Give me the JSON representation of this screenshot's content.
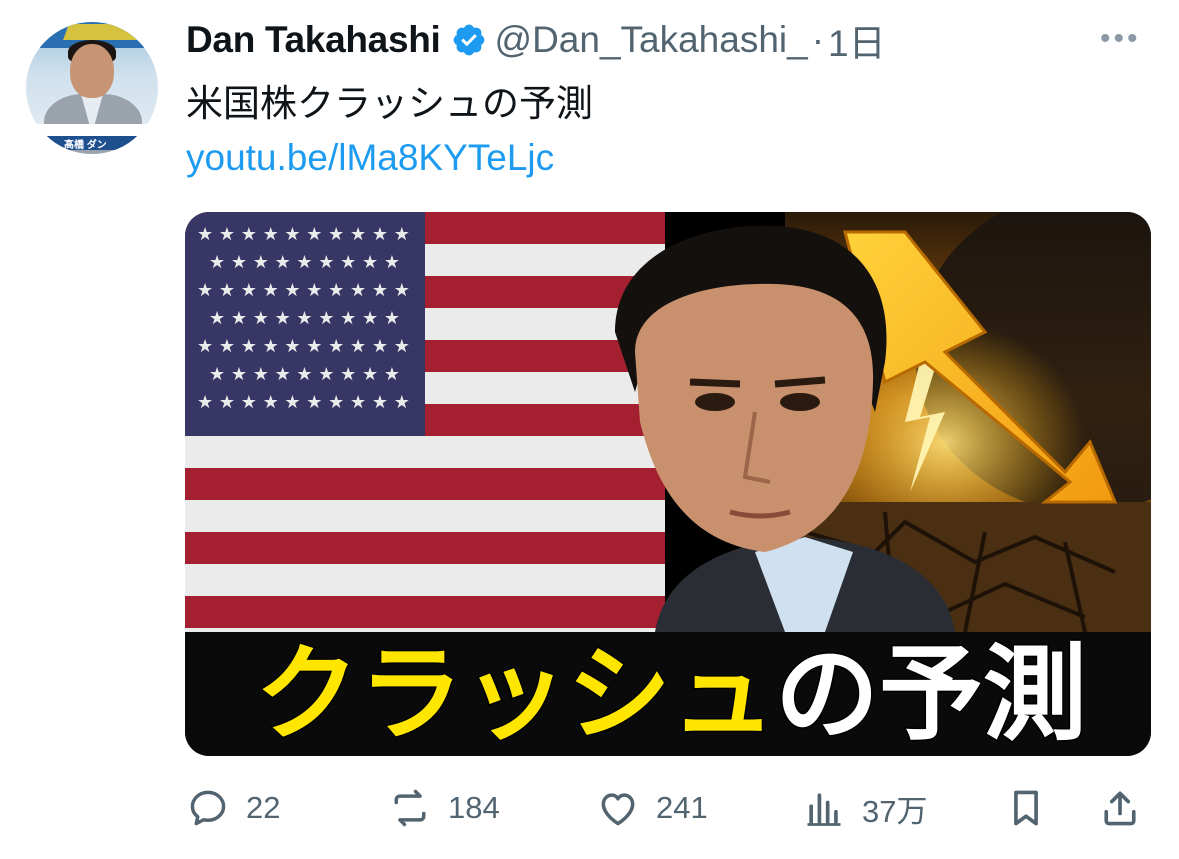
{
  "tweet": {
    "author_name": "Dan Takahashi",
    "handle": "@Dan_Takahashi_",
    "separator": "·",
    "time": "1日",
    "more_label": "•••",
    "text": "米国株クラッシュの予測",
    "link": "youtu.be/lMa8KYTeLjc",
    "avatar_caption": "髙橋 ダン",
    "verified_color": "#1d9bf0",
    "link_color": "#1d9bf0"
  },
  "media": {
    "headline_yellow": "クラッシュ",
    "headline_white": "の予測",
    "headline_yellow_color": "#ffe600",
    "headline_white_color": "#ffffff"
  },
  "actions": {
    "reply": {
      "icon": "reply-icon",
      "count": "22"
    },
    "repost": {
      "icon": "repost-icon",
      "count": "184"
    },
    "like": {
      "icon": "heart-icon",
      "count": "241"
    },
    "views": {
      "icon": "views-icon",
      "count": "37万"
    },
    "bookmark": {
      "icon": "bookmark-icon"
    },
    "share": {
      "icon": "share-icon"
    }
  }
}
